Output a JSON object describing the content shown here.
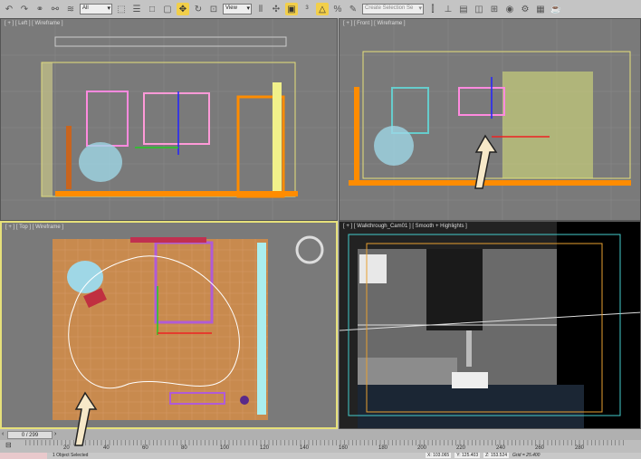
{
  "toolbar": {
    "selection_filter": "All",
    "reference_coord": "View",
    "named_selection_placeholder": "Create Selection Se",
    "icons": [
      "undo-icon",
      "redo-icon",
      "link-icon",
      "unlink-icon",
      "bind-space-warp-icon",
      "select-object-icon",
      "select-by-name-icon",
      "rect-region-icon",
      "window-crossing-icon",
      "move-icon",
      "rotate-icon",
      "scale-icon",
      "mirror-icon",
      "pivot-icon",
      "snap-3d-icon",
      "angle-snap-icon",
      "percent-snap-icon",
      "spinner-snap-icon",
      "edit-named-sel-icon",
      "mirror-tool-icon",
      "align-icon",
      "layer-icon",
      "curve-editor-icon",
      "schematic-icon",
      "material-editor-icon",
      "render-setup-icon",
      "render-frame-icon",
      "render-icon"
    ]
  },
  "viewports": {
    "left": {
      "label": "[ + ] [ Left ] [ Wireframe ]"
    },
    "front": {
      "label": "[ + ] [ Front ] [ Wireframe ]"
    },
    "top": {
      "label": "[ + ] [ Top ] [ Wireframe ]"
    },
    "camera": {
      "label": "[ + ] [ Walkthrough_Cam01 ] [ Smooth + Highlights ]"
    }
  },
  "timeline": {
    "frame": "0 / 299",
    "ticks": [
      "20",
      "40",
      "60",
      "80",
      "100",
      "120",
      "140",
      "160",
      "180",
      "200",
      "220",
      "240",
      "260",
      "280"
    ]
  },
  "status": {
    "message": "1 Object Selected",
    "x": "X: 103.065",
    "y": "Y: 125.403",
    "z": "Z: 153.524",
    "grid": "Grid = 25.400"
  },
  "colors": {
    "active_border": "#e6e07a",
    "viewport_bg": "#7a7a7a",
    "accent": "#f2cf4a"
  }
}
